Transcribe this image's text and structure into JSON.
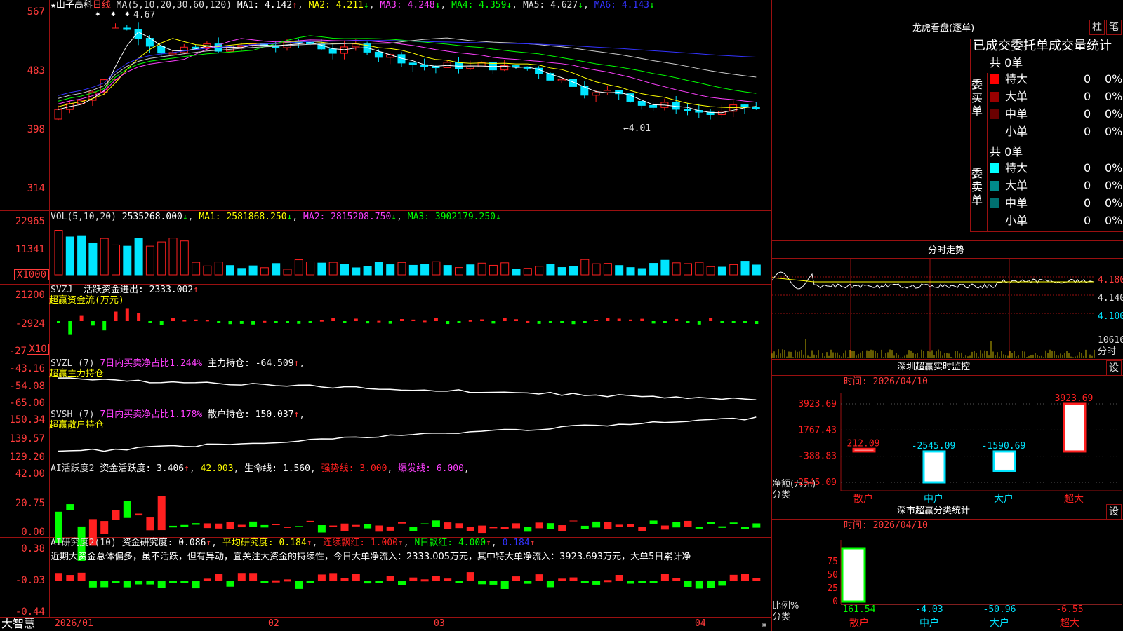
{
  "app": {
    "brand": "大智慧",
    "stock": "★山子高科",
    "period": "日线"
  },
  "colors": {
    "up": "#ff2020",
    "down": "#00e5ff",
    "grid": "#9a1010",
    "label": "#ff3b3b"
  },
  "kline": {
    "header": {
      "ma_label": "MA(5,10,20,30,60,120)",
      "ma1": "MA1: 4.142",
      "ma2": "MA2: 4.211",
      "ma3": "MA3: 4.248",
      "ma4": "MA4: 4.359",
      "ma5": "MA5: 4.627",
      "ma6": "MA6: 4.143"
    },
    "y_labels": [
      "567",
      "483",
      "398",
      "314"
    ],
    "high_mark": "4.67",
    "low_mark": "←4.01",
    "markers": [
      "✱",
      "✱",
      "✱"
    ]
  },
  "volume": {
    "header": {
      "label": "VOL(5,10,20)",
      "value": "2535268.000",
      "ma1": "MA1: 2581868.250",
      "ma2": "MA2: 2815208.750",
      "ma3": "MA3: 3902179.250"
    },
    "y_labels": [
      "22965",
      "11341",
      "X1000"
    ]
  },
  "svzj": {
    "header": {
      "label": "SVZJ",
      "text": "活跃资金进出: 2333.002"
    },
    "subtitle": "超赢资金流(万元)",
    "y_labels": [
      "21200",
      "-2924",
      "-27",
      "X10"
    ]
  },
  "svzl": {
    "header": {
      "label": "SVZL (7)",
      "text": "7日内买卖净占比1.244%",
      "hold": "主力持仓: -64.509"
    },
    "subtitle": "超赢主力持仓",
    "y_labels": [
      "-43.16",
      "-54.08",
      "-65.00"
    ]
  },
  "svsh": {
    "header": {
      "label": "SVSH (7)",
      "text": "7日内买卖净占比1.178%",
      "hold": "散户持仓: 150.037"
    },
    "subtitle": "超赢散户持仓",
    "y_labels": [
      "150.34",
      "139.57",
      "129.20"
    ]
  },
  "ai1": {
    "header": {
      "label": "AI活跃度2",
      "a": "资金活跃度: 3.406",
      "b": "42.003",
      "c": "生命线: 1.560",
      "d": "强势线: 3.000",
      "e": "爆发线: 6.000"
    },
    "y_labels": [
      "42.00",
      "20.75",
      "0.00"
    ]
  },
  "ai2": {
    "header": {
      "label": "AI研究度2(10)",
      "a": "资金研究度: 0.086",
      "b": "平均研究度: 0.184",
      "c": "连续飘红: 1.000",
      "d": "N日飘红: 4.000",
      "e": "0.184"
    },
    "comment": "近期大资金总体偏多，虽不活跃，但有异动，宜关注大资金的持续性，今日大单净流入：2333.005万元，其中特大单净流入：3923.693万元，大单5日累计净",
    "y_labels": [
      "0.38",
      "-0.03",
      "-0.44"
    ]
  },
  "xaxis": {
    "labels": [
      "2026/01",
      "02",
      "03",
      "04"
    ]
  },
  "dragon": {
    "title": "龙虎看盘(逐单)",
    "tab1": "柱",
    "tab2": "笔",
    "subtitle": "已成交委托单成交量统计",
    "buy": {
      "side_label": "委买单",
      "total": "共 0单",
      "rows": [
        {
          "name": "特大",
          "value": "0",
          "pct": "0%",
          "color": "#ff0000"
        },
        {
          "name": "大单",
          "value": "0",
          "pct": "0%",
          "color": "#9a0000"
        },
        {
          "name": "中单",
          "value": "0",
          "pct": "0%",
          "color": "#6a0000"
        },
        {
          "name": "小单",
          "value": "0",
          "pct": "0%",
          "color": ""
        }
      ]
    },
    "sell": {
      "side_label": "委卖单",
      "total": "共 0单",
      "rows": [
        {
          "name": "特大",
          "value": "0",
          "pct": "0%",
          "color": "#00ffff"
        },
        {
          "name": "大单",
          "value": "0",
          "pct": "0%",
          "color": "#008a8a"
        },
        {
          "name": "中单",
          "value": "0",
          "pct": "0%",
          "color": "#007070"
        },
        {
          "name": "小单",
          "value": "0",
          "pct": "0%",
          "color": ""
        }
      ]
    }
  },
  "intraday": {
    "title": "分时走势",
    "prices": [
      "4.180",
      "4.140",
      "4.100"
    ],
    "vol_label": "10616",
    "unit": "分时"
  },
  "monitor": {
    "title": "深圳超赢实时监控",
    "button": "设",
    "time": "时间: 2026/04/10",
    "y_labels": [
      "3923.69",
      "1767.43",
      "-388.83",
      "-2545.09"
    ],
    "unit1": "净额(万元)",
    "unit2": "分类",
    "bars": [
      {
        "cat": "散户",
        "value": "212.09"
      },
      {
        "cat": "中户",
        "value": "-2545.09"
      },
      {
        "cat": "大户",
        "value": "-1590.69"
      },
      {
        "cat": "超大",
        "value": "3923.69"
      }
    ]
  },
  "classify": {
    "title": "深市超赢分类统计",
    "button": "设",
    "time": "时间: 2026/04/10",
    "y_labels": [
      "75",
      "50",
      "25",
      "0"
    ],
    "unit1": "比例%",
    "unit2": "分类",
    "bars": [
      {
        "cat": "散户",
        "value": "161.54"
      },
      {
        "cat": "中户",
        "value": "-4.03"
      },
      {
        "cat": "大户",
        "value": "-50.96"
      },
      {
        "cat": "超大",
        "value": "-6.55"
      }
    ]
  }
}
